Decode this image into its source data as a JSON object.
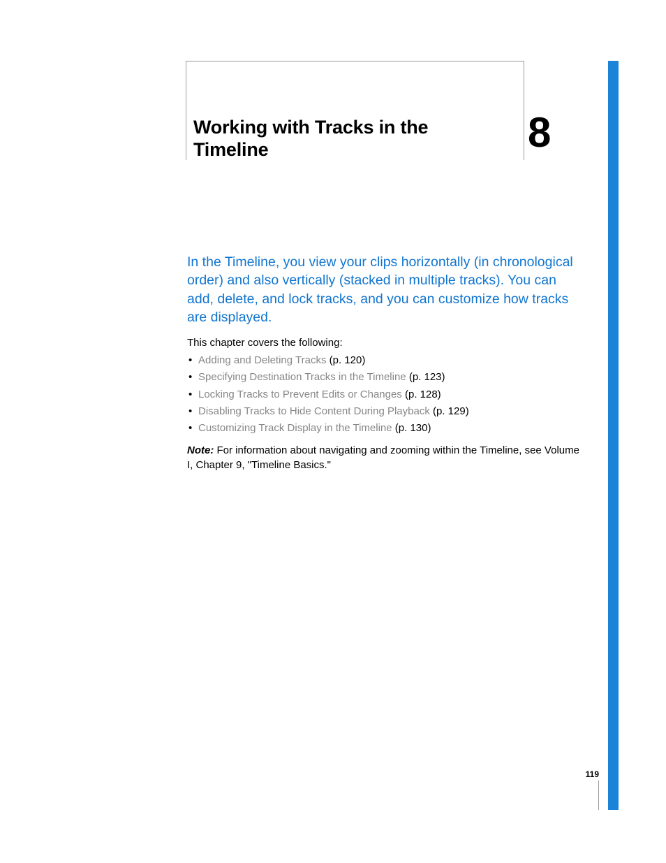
{
  "chapter": {
    "title": "Working with Tracks in the Timeline",
    "number": "8"
  },
  "intro": "In the Timeline, you view your clips horizontally (in chronological order) and also vertically (stacked in multiple tracks). You can add, delete, and lock tracks, and you can customize how tracks are displayed.",
  "covers_label": "This chapter covers the following:",
  "toc": [
    {
      "title": "Adding and Deleting Tracks",
      "page": "(p. 120)"
    },
    {
      "title": "Specifying Destination Tracks in the Timeline",
      "page": "(p. 123)"
    },
    {
      "title": "Locking Tracks to Prevent Edits or Changes",
      "page": "(p. 128)"
    },
    {
      "title": "Disabling Tracks to Hide Content During Playback",
      "page": "(p. 129)"
    },
    {
      "title": "Customizing Track Display in the Timeline",
      "page": "(p. 130)"
    }
  ],
  "note": {
    "label": "Note:",
    "text": "  For information about navigating and zooming within the Timeline, see Volume I, Chapter 9, \"Timeline Basics.\""
  },
  "page_number": "119"
}
